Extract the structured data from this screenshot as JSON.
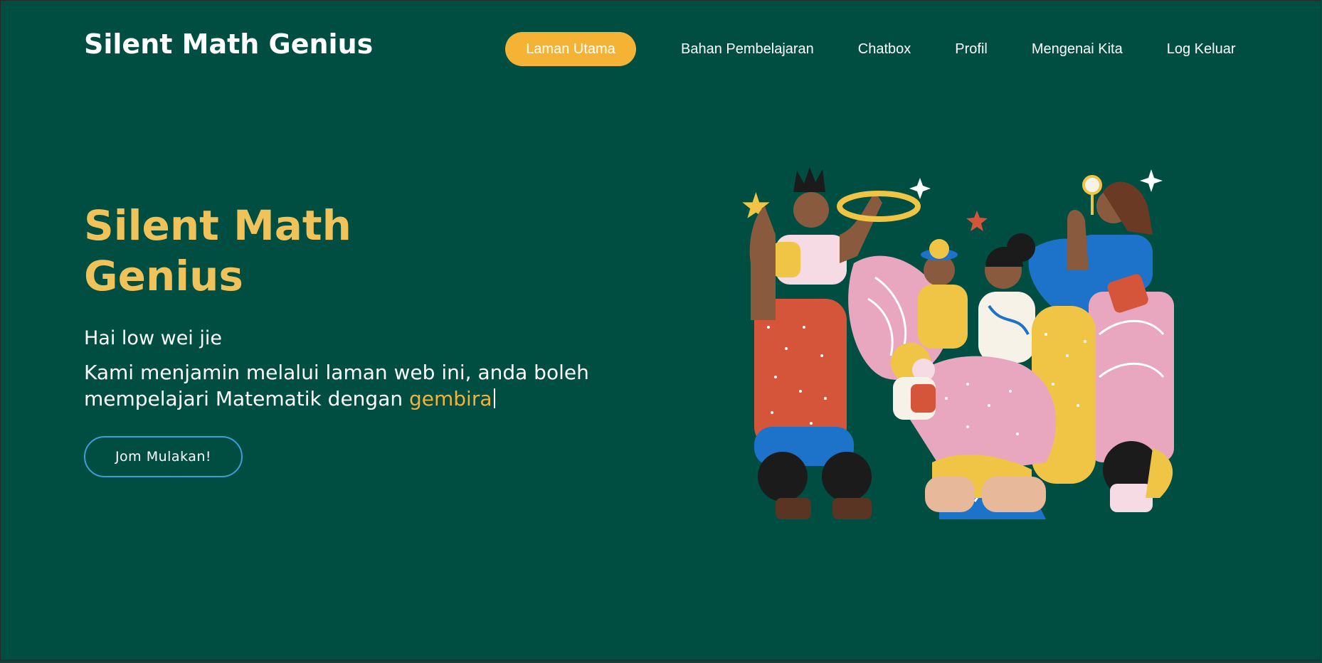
{
  "header": {
    "brand": "Silent Math Genius",
    "nav": [
      {
        "label": "Laman Utama",
        "active": true
      },
      {
        "label": "Bahan Pembelajaran",
        "active": false
      },
      {
        "label": "Chatbox",
        "active": false
      },
      {
        "label": "Profil",
        "active": false
      },
      {
        "label": "Mengenai Kita",
        "active": false
      },
      {
        "label": "Log Keluar",
        "active": false
      }
    ]
  },
  "hero": {
    "title_line1": "Silent Math",
    "title_line2": "Genius",
    "greeting": "Hai low wei jie",
    "tagline_text": "Kami menjamin melalui laman web ini, anda boleh mempelajari Matematik dengan ",
    "tagline_highlight": "gembira",
    "cta_label": "Jom Mulakan!"
  },
  "illustration": {
    "icon": "group-of-people-celebrating-illustration"
  },
  "colors": {
    "background": "#004e42",
    "accent": "#f5b335",
    "title": "#efc35a",
    "cta_border": "#3d9fd8"
  }
}
